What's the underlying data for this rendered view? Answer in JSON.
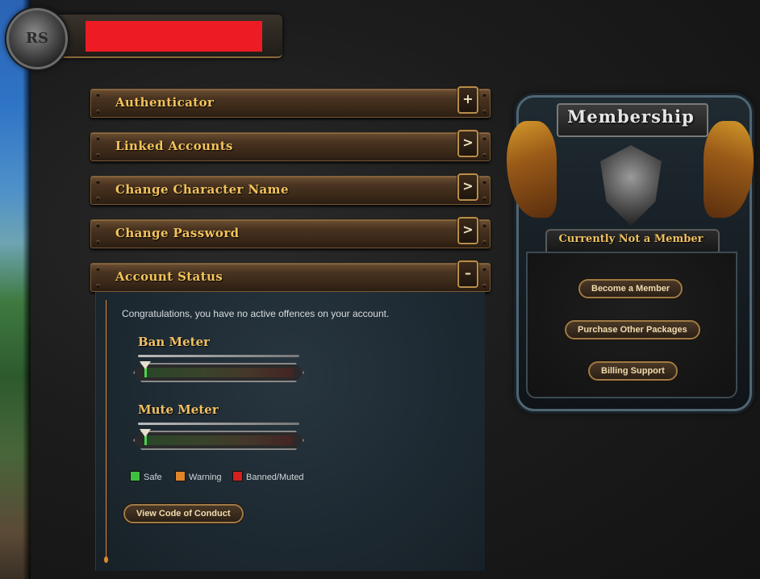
{
  "sections": [
    {
      "label": "Authenticator",
      "button": "+"
    },
    {
      "label": "Linked Accounts",
      "button": ">"
    },
    {
      "label": "Change Character Name",
      "button": ">"
    },
    {
      "label": "Change Password",
      "button": ">"
    },
    {
      "label": "Account Status",
      "button": "–"
    }
  ],
  "account_status": {
    "message": "Congratulations, you have no active offences on your account.",
    "ban_meter": {
      "title": "Ban Meter",
      "level": 0
    },
    "mute_meter": {
      "title": "Mute Meter",
      "level": 0
    },
    "legend": [
      {
        "label": "Safe",
        "color": "#3fbf3f"
      },
      {
        "label": "Warning",
        "color": "#e0852a"
      },
      {
        "label": "Banned/Muted",
        "color": "#d42020"
      }
    ],
    "conduct_button": "View Code of Conduct"
  },
  "membership": {
    "title": "Membership",
    "status": "Currently Not a Member",
    "buttons": [
      "Become a Member",
      "Purchase Other Packages",
      "Billing Support"
    ]
  },
  "header": {
    "logo_text": "RS",
    "redacted_color": "#ed1c24"
  }
}
